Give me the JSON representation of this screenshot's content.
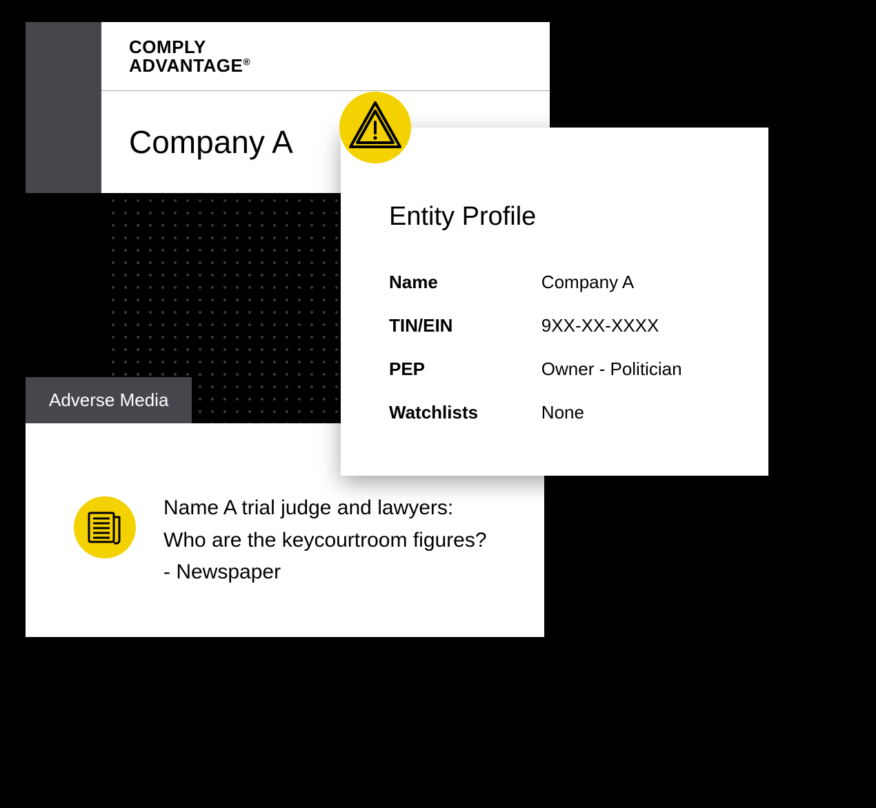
{
  "colors": {
    "accent_yellow": "#f4d100",
    "spine_grey": "#46474c"
  },
  "brand": {
    "line1": "COMPLY",
    "line2": "ADVANTAGE",
    "registered_symbol": "®"
  },
  "company": {
    "name": "Company A"
  },
  "entity_profile": {
    "title": "Entity Profile",
    "fields": [
      {
        "label": "Name",
        "value": "Company A"
      },
      {
        "label": "TIN/EIN",
        "value": "9XX-XX-XXXX"
      },
      {
        "label": "PEP",
        "value": "Owner - Politician"
      },
      {
        "label": "Watchlists",
        "value": "None"
      }
    ],
    "alert_icon": "warning-triangle-icon"
  },
  "adverse_media": {
    "tab_label": "Adverse Media",
    "icon": "newspaper-icon",
    "headline_line1": "Name A trial judge and lawyers:",
    "headline_line2": "Who are the keycourtroom figures?",
    "headline_line3": "- Newspaper"
  }
}
